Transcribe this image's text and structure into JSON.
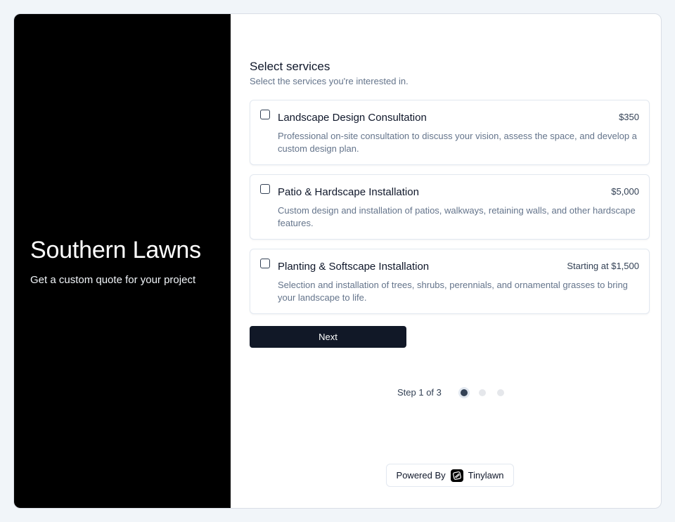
{
  "brand": {
    "title": "Southern Lawns",
    "subtitle": "Get a custom quote for your project"
  },
  "form": {
    "title": "Select services",
    "subtitle": "Select the services you're interested in.",
    "services": [
      {
        "name": "Landscape Design Consultation",
        "price": "$350",
        "description": "Professional on-site consultation to discuss your vision, assess the space, and develop a custom design plan.",
        "checked": false
      },
      {
        "name": "Patio & Hardscape Installation",
        "price": "$5,000",
        "description": "Custom design and installation of patios, walkways, retaining walls, and other hardscape features.",
        "checked": false
      },
      {
        "name": "Planting & Softscape Installation",
        "price": "Starting at $1,500",
        "description": "Selection and installation of trees, shrubs, perennials, and ornamental grasses to bring your landscape to life.",
        "checked": false
      }
    ],
    "next_label": "Next"
  },
  "stepper": {
    "text": "Step 1 of 3",
    "current": 1,
    "total": 3
  },
  "footer": {
    "powered_by": "Powered By",
    "vendor": "Tinylawn",
    "logo_icon": "tinylawn-logo-icon"
  },
  "colors": {
    "brand_panel": "#000000",
    "button": "#111827",
    "active_dot": "#334155"
  }
}
